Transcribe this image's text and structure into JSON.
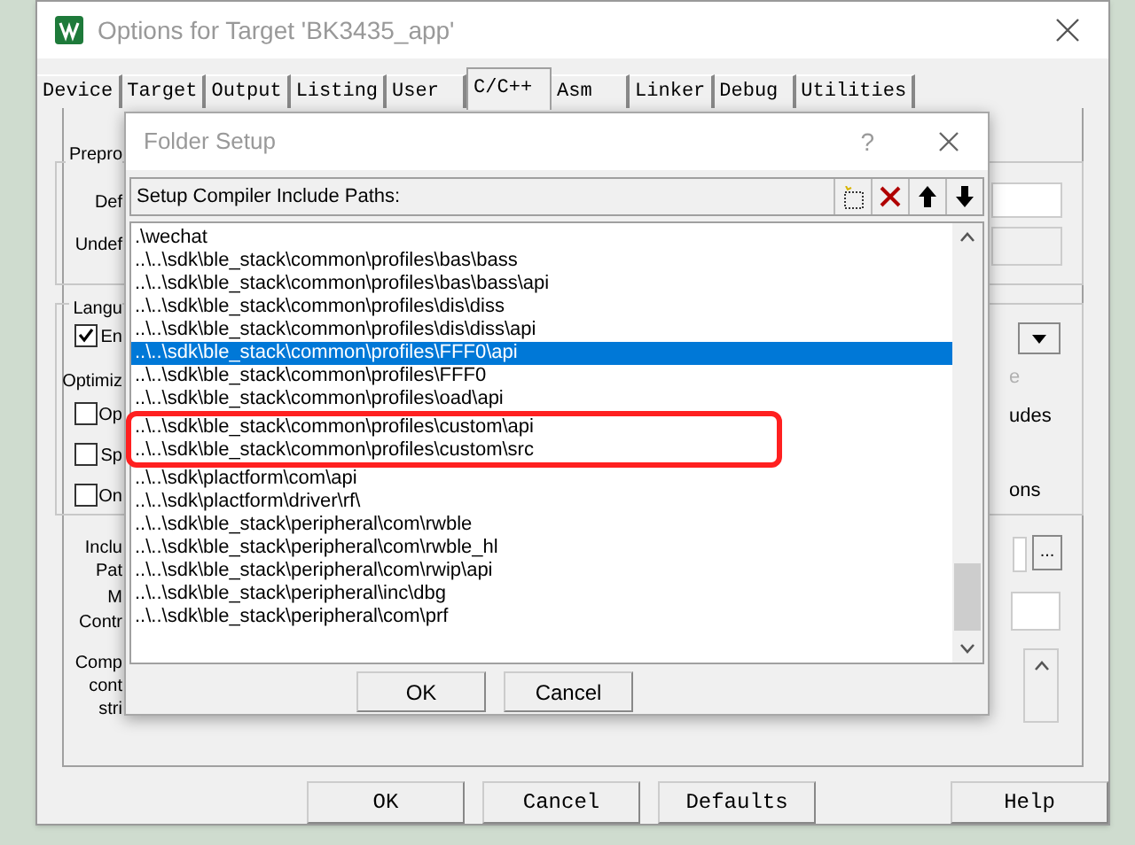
{
  "window": {
    "title": "Options for Target 'BK3435_app'"
  },
  "tabs": [
    {
      "label": "Device",
      "selected": false
    },
    {
      "label": "Target",
      "selected": false
    },
    {
      "label": "Output",
      "selected": false
    },
    {
      "label": "Listing",
      "selected": false
    },
    {
      "label": "User",
      "selected": false
    },
    {
      "label": "C/C++",
      "selected": true
    },
    {
      "label": "Asm",
      "selected": false
    },
    {
      "label": "Linker",
      "selected": false
    },
    {
      "label": "Debug",
      "selected": false
    },
    {
      "label": "Utilities",
      "selected": false
    }
  ],
  "options_panel": {
    "preprocessor_group": "Prepro",
    "define_label": "Def",
    "undefine_label": "Undef",
    "language_group": "Langu",
    "optimization_label": "Optimiz",
    "checkboxes": [
      {
        "label": "En",
        "checked": true
      },
      {
        "label": "Op",
        "checked": false
      },
      {
        "label": "Sp",
        "checked": false
      },
      {
        "label": "On",
        "checked": false
      }
    ],
    "right_fragments": [
      {
        "text": "e",
        "disabled": true
      },
      {
        "text": "udes",
        "disabled": false
      },
      {
        "text": "ons",
        "disabled": false
      }
    ],
    "include_labels": [
      "Inclu",
      "Pat"
    ],
    "misc_label": "M",
    "controls_label": "Contr",
    "compiler_labels": [
      "Comp",
      "cont",
      "stri"
    ],
    "browse_button": "..."
  },
  "folder_setup": {
    "title": "Folder Setup",
    "help": "?",
    "toolbar_label": "Setup Compiler Include Paths:",
    "paths": [
      {
        "text": ".\\wechat",
        "selected": false,
        "marked": false
      },
      {
        "text": "..\\..\\sdk\\ble_stack\\common\\profiles\\bas\\bass",
        "selected": false,
        "marked": false
      },
      {
        "text": "..\\..\\sdk\\ble_stack\\common\\profiles\\bas\\bass\\api",
        "selected": false,
        "marked": false
      },
      {
        "text": "..\\..\\sdk\\ble_stack\\common\\profiles\\dis\\diss",
        "selected": false,
        "marked": false
      },
      {
        "text": "..\\..\\sdk\\ble_stack\\common\\profiles\\dis\\diss\\api",
        "selected": false,
        "marked": false
      },
      {
        "text": "..\\..\\sdk\\ble_stack\\common\\profiles\\FFF0\\api",
        "selected": true,
        "marked": false
      },
      {
        "text": "..\\..\\sdk\\ble_stack\\common\\profiles\\FFF0",
        "selected": false,
        "marked": false
      },
      {
        "text": "..\\..\\sdk\\ble_stack\\common\\profiles\\oad\\api",
        "selected": false,
        "marked": false
      },
      {
        "text": "..\\..\\sdk\\ble_stack\\common\\profiles\\custom\\api",
        "selected": false,
        "marked": true
      },
      {
        "text": "..\\..\\sdk\\ble_stack\\common\\profiles\\custom\\src",
        "selected": false,
        "marked": true
      },
      {
        "text": "..\\..\\sdk\\plactform\\com\\api",
        "selected": false,
        "marked": false
      },
      {
        "text": "..\\..\\sdk\\plactform\\driver\\rf\\",
        "selected": false,
        "marked": false
      },
      {
        "text": "..\\..\\sdk\\ble_stack\\peripheral\\com\\rwble",
        "selected": false,
        "marked": false
      },
      {
        "text": "..\\..\\sdk\\ble_stack\\peripheral\\com\\rwble_hl",
        "selected": false,
        "marked": false
      },
      {
        "text": "..\\..\\sdk\\ble_stack\\peripheral\\com\\rwip\\api",
        "selected": false,
        "marked": false
      },
      {
        "text": "..\\..\\sdk\\ble_stack\\peripheral\\inc\\dbg",
        "selected": false,
        "marked": false
      },
      {
        "text": "..\\..\\sdk\\ble_stack\\peripheral\\com\\prf",
        "selected": false,
        "marked": false
      }
    ],
    "buttons": [
      "OK",
      "Cancel"
    ]
  },
  "buttons": [
    "OK",
    "Cancel",
    "Defaults",
    "Help"
  ]
}
